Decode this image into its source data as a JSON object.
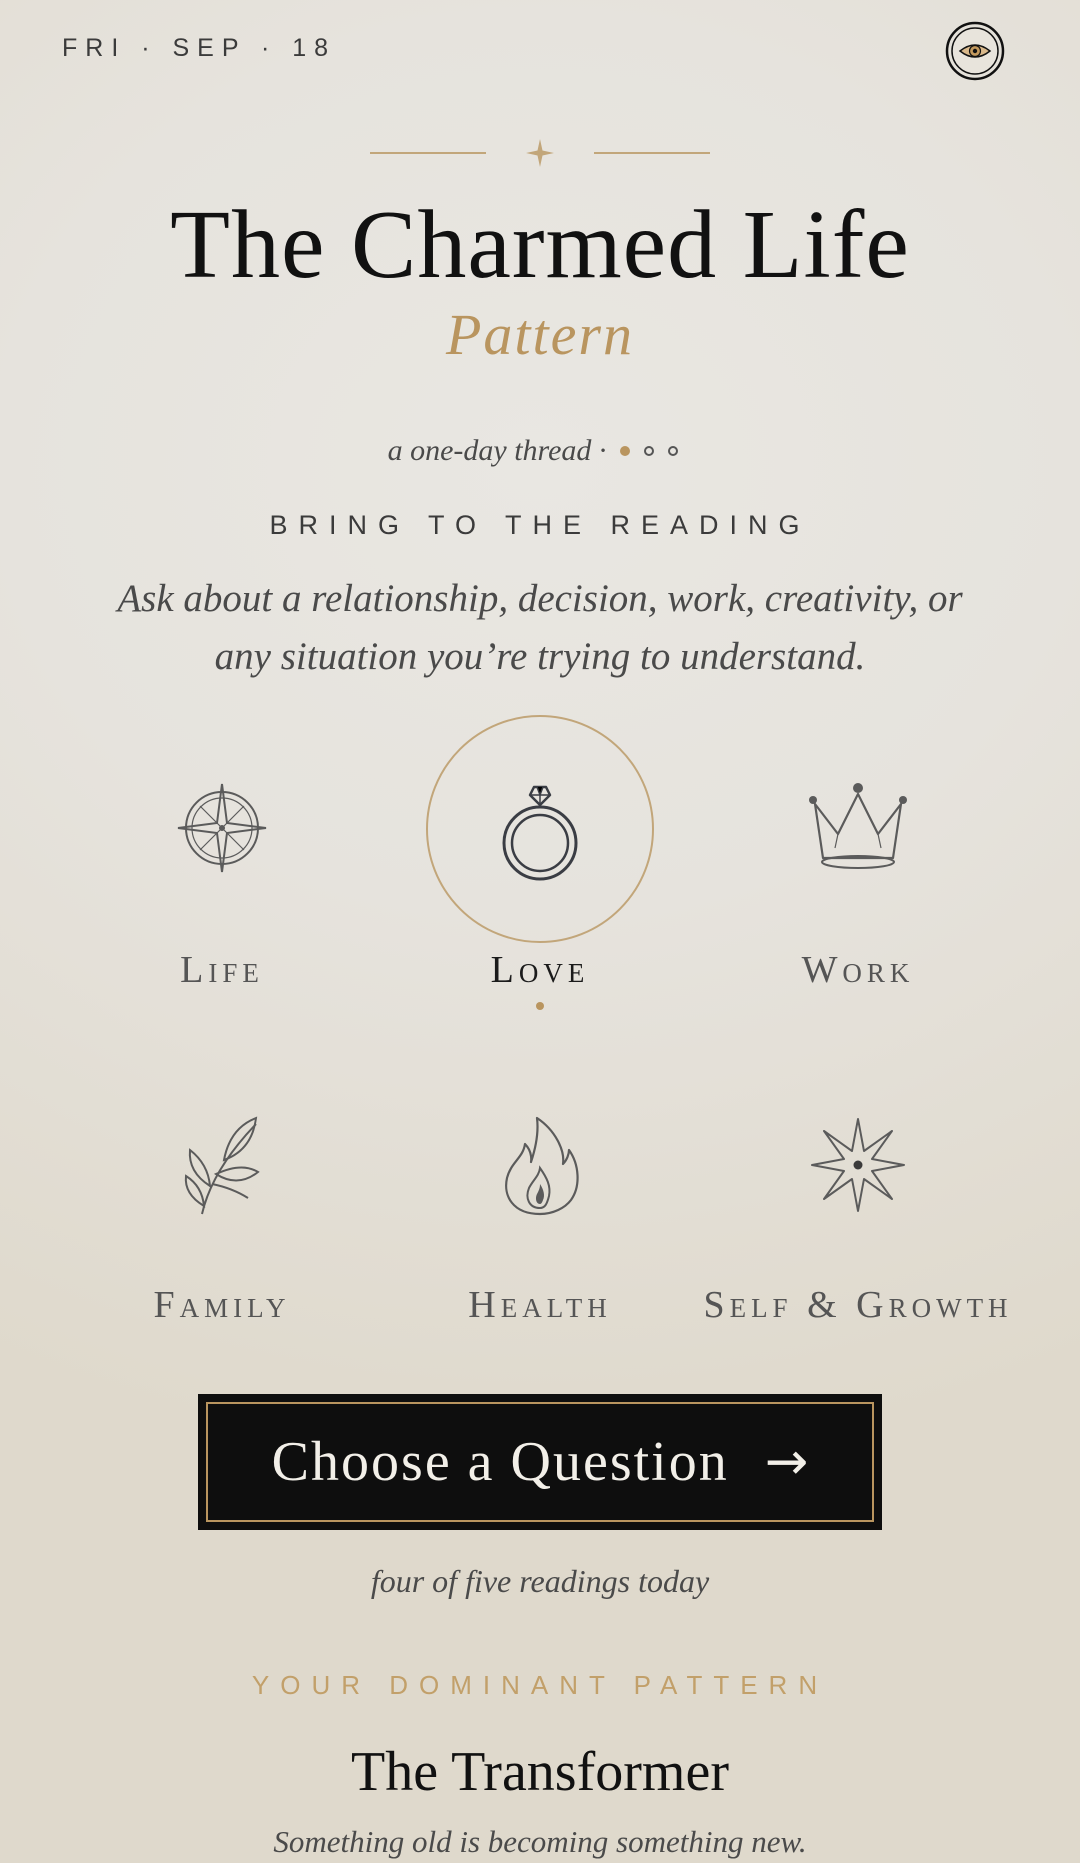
{
  "header": {
    "date": "FRI · SEP · 18",
    "eye_icon": "eye-icon"
  },
  "hero": {
    "title": "The Charmed Life",
    "subtitle": "Pattern"
  },
  "thread": {
    "text": "a one-day thread ·",
    "progress_dots": {
      "total": 3,
      "filled": 1
    }
  },
  "prompt_section": {
    "label": "BRING TO THE READING",
    "body": "Ask about a relationship, decision, work, creativity, or any situation you’re trying to understand."
  },
  "categories": [
    {
      "label": "Life",
      "icon": "compass-icon",
      "selected": false
    },
    {
      "label": "Love",
      "icon": "ring-icon",
      "selected": true
    },
    {
      "label": "Work",
      "icon": "crown-icon",
      "selected": false
    },
    {
      "label": "Family",
      "icon": "leaf-branch-icon",
      "selected": false
    },
    {
      "label": "Health",
      "icon": "flame-icon",
      "selected": false
    },
    {
      "label": "Self & Growth",
      "icon": "star-icon",
      "selected": false
    }
  ],
  "cta": {
    "label": "Choose a Question",
    "arrow": "→"
  },
  "readings_count": "four of five readings today",
  "dominant": {
    "label": "YOUR DOMINANT PATTERN",
    "name": "The Transformer",
    "description": "Something old is becoming something new."
  },
  "colors": {
    "accent_gold": "#b9955f",
    "cta_background": "#0e0e0e",
    "text_dark": "#111111"
  }
}
